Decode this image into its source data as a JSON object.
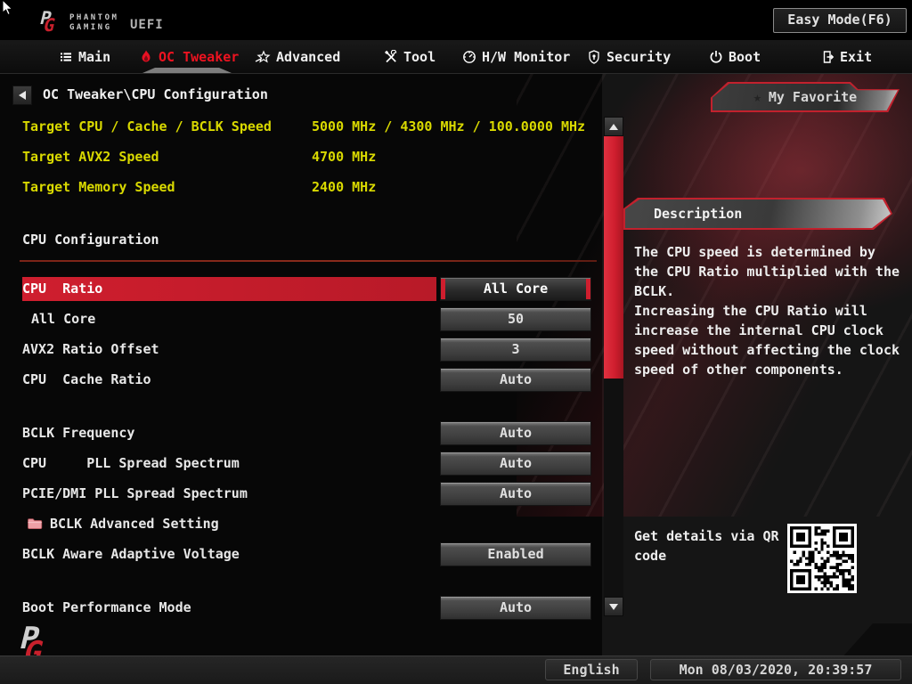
{
  "colors": {
    "accent": "#cf1e2e",
    "target-yellow": "#d9d900",
    "nav-active": "#ee1320"
  },
  "header": {
    "brand_line1": "PHANTOM",
    "brand_line2": "GAMING",
    "brand_uefi": "UEFI",
    "easy_mode_label": "Easy Mode(F6)"
  },
  "nav": {
    "items": [
      {
        "label": "Main",
        "icon": "list-icon",
        "active": false
      },
      {
        "label": "OC Tweaker",
        "icon": "flame-icon",
        "active": true
      },
      {
        "label": "Advanced",
        "icon": "star-icon",
        "active": false
      },
      {
        "label": "Tool",
        "icon": "tools-icon",
        "active": false
      },
      {
        "label": "H/W Monitor",
        "icon": "gauge-icon",
        "active": false
      },
      {
        "label": "Security",
        "icon": "shield-icon",
        "active": false
      },
      {
        "label": "Boot",
        "icon": "power-icon",
        "active": false
      },
      {
        "label": "Exit",
        "icon": "door-icon",
        "active": false
      }
    ]
  },
  "breadcrumb": {
    "path": "OC Tweaker\\CPU Configuration"
  },
  "favorite_tab": {
    "label": "My Favorite",
    "star": "★"
  },
  "targets": [
    {
      "label": "Target CPU / Cache / BCLK Speed",
      "value": "5000 MHz / 4300 MHz / 100.0000 MHz"
    },
    {
      "label": "Target AVX2 Speed",
      "value": "4700 MHz"
    },
    {
      "label": "Target Memory Speed",
      "value": "2400 MHz"
    }
  ],
  "section": {
    "title": "CPU Configuration"
  },
  "rows": [
    {
      "label": "CPU  Ratio",
      "value": "All Core",
      "selected": true
    },
    {
      "label": "All Core",
      "value": "50"
    },
    {
      "label": "AVX2 Ratio Offset",
      "value": "3"
    },
    {
      "label": "CPU  Cache Ratio",
      "value": "Auto"
    },
    {
      "label": "BCLK Frequency",
      "value": "Auto"
    },
    {
      "label": "CPU     PLL Spread Spectrum",
      "value": "Auto"
    },
    {
      "label": "PCIE/DMI PLL Spread Spectrum",
      "value": "Auto"
    },
    {
      "label": "BCLK Advanced Setting",
      "folder": true
    },
    {
      "label": "BCLK Aware Adaptive Voltage",
      "value": "Enabled"
    },
    {
      "label": "Boot Performance Mode",
      "value": "Auto"
    }
  ],
  "description": {
    "title": "Description",
    "text": "The CPU speed is determined by the CPU Ratio multiplied with the BCLK.\nIncreasing the CPU Ratio will increase the internal CPU clock speed without affecting the clock speed of other components."
  },
  "qr": {
    "caption": "Get details via QR code"
  },
  "footer": {
    "language": "English",
    "datetime": "Mon 08/03/2020, 20:39:57"
  }
}
